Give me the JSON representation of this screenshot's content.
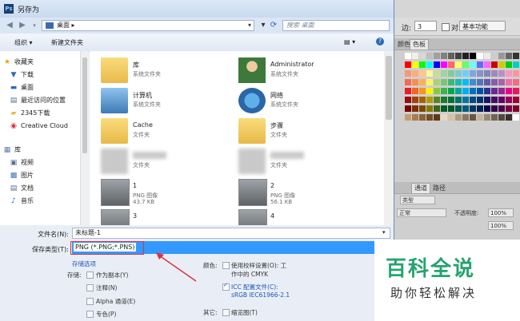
{
  "dialog": {
    "title": "另存为",
    "address": {
      "crumb": "桌面",
      "arrow": "▸"
    },
    "search_placeholder": "搜索 桌面",
    "toolbar": {
      "organize": "组织 ▾",
      "new_folder": "新建文件夹"
    },
    "nav": [
      {
        "icon": "star-icon",
        "label": "收藏夹"
      },
      {
        "icon": "download-folder-icon",
        "label": "下载"
      },
      {
        "icon": "desktop-icon",
        "label": "桌面"
      },
      {
        "icon": "recent-places-icon",
        "label": "最近访问的位置"
      },
      {
        "icon": "folder-icon",
        "label": "2345下载"
      },
      {
        "icon": "creative-cloud-icon",
        "label": "Creative Cloud"
      },
      {
        "icon": "library-icon",
        "label": "库"
      },
      {
        "icon": "video-icon",
        "label": "视频"
      },
      {
        "icon": "picture-icon",
        "label": "图片"
      },
      {
        "icon": "document-icon",
        "label": "文档"
      },
      {
        "icon": "music-icon",
        "label": "音乐"
      }
    ],
    "files": [
      {
        "name": "库",
        "sub": "系统文件夹",
        "sub2": ""
      },
      {
        "name": "Administrator",
        "sub": "系统文件夹",
        "sub2": ""
      },
      {
        "name": "计算机",
        "sub": "系统文件夹",
        "sub2": ""
      },
      {
        "name": "网络",
        "sub": "系统文件夹",
        "sub2": ""
      },
      {
        "name": "Cache",
        "sub": "文件夹",
        "sub2": ""
      },
      {
        "name": "步骤",
        "sub": "文件夹",
        "sub2": ""
      },
      {
        "name": "",
        "sub": "文件夹",
        "sub2": ""
      },
      {
        "name": "",
        "sub": "文件夹",
        "sub2": ""
      },
      {
        "name": "1",
        "sub": "PNG 图像",
        "sub2": "43.7 KB"
      },
      {
        "name": "2",
        "sub": "PNG 图像",
        "sub2": "56.1 KB"
      },
      {
        "name": "3",
        "sub": "",
        "sub2": ""
      },
      {
        "name": "4",
        "sub": "",
        "sub2": ""
      }
    ],
    "form": {
      "filename_label": "文件名(N):",
      "filename_value": "未标题-1",
      "filetype_label": "保存类型(T):",
      "filetype_value": "PNG (*.PNG;*.PNS)",
      "save_options": "存储选项",
      "store_label": "存储:",
      "as_copy": "作为副本(Y)",
      "notes": "注释(N)",
      "alpha": "Alpha 通道(E)",
      "spot": "专色(P)",
      "color_label": "颜色:",
      "proof": "使用校样设置(O): 工",
      "proof2": "作中的 CMYK",
      "icc": "ICC 配置文件(C):",
      "icc_value": "sRGB IEC61966-2.1",
      "other_label": "其它:",
      "thumbnail": "缩览图(T)"
    }
  },
  "photoshop": {
    "edge_label": "边:",
    "edge_value": "3",
    "checkbox_label": "对",
    "workspace": "基本功能",
    "tab_color": "颜色",
    "tab_swatches": "色板",
    "tab_channels": "通道",
    "tab_paths": "路径",
    "kind": "类型",
    "normal": "正常",
    "opacity_label": "不透明度:",
    "opacity_value": "100%",
    "fill_value": "100%"
  },
  "watermark": {
    "title": "百科全说",
    "subtitle": "助你轻松解决"
  },
  "colors": {
    "accent": "#3399ff",
    "highlight": "#e0313a",
    "watermark": "#26a36f"
  }
}
